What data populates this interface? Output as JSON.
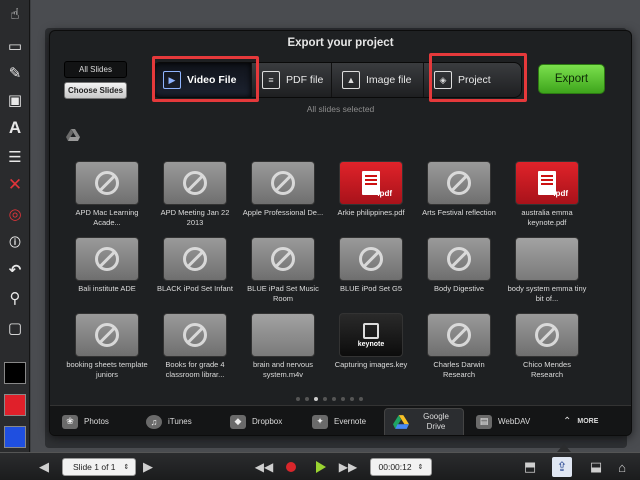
{
  "dialog": {
    "title": "Export your project",
    "scope_all": "All Slides",
    "scope_choose": "Choose Slides",
    "selected_prefix": "All",
    "selected_suffix": "slides selected",
    "export_label": "Export"
  },
  "formats": [
    {
      "label": "Video File",
      "icon": "film-icon"
    },
    {
      "label": "PDF file",
      "icon": "document-icon"
    },
    {
      "label": "Image file",
      "icon": "image-icon"
    },
    {
      "label": "Project",
      "icon": "project-icon"
    }
  ],
  "files": [
    {
      "name": "APD Mac Learning Acade...",
      "type": "blocked"
    },
    {
      "name": "APD Meeting Jan 22 2013",
      "type": "blocked"
    },
    {
      "name": "Apple Professional De...",
      "type": "blocked"
    },
    {
      "name": "Arkie philippines.pdf",
      "type": "pdf"
    },
    {
      "name": "Arts Festival reflection",
      "type": "blocked"
    },
    {
      "name": "australia emma keynote.pdf",
      "type": "pdf"
    },
    {
      "name": "Bali institute ADE",
      "type": "blocked"
    },
    {
      "name": "BLACK iPod Set Infant",
      "type": "blocked"
    },
    {
      "name": "BLUE iPad Set Music Room",
      "type": "blocked"
    },
    {
      "name": "BLUE iPod Set G5",
      "type": "blocked"
    },
    {
      "name": "Body Digestive",
      "type": "blocked"
    },
    {
      "name": "body system emma tiny bit of...",
      "type": "plain"
    },
    {
      "name": "booking sheets template juniors",
      "type": "blocked"
    },
    {
      "name": "Books for grade 4 classroom librar...",
      "type": "blocked"
    },
    {
      "name": "brain and nervous system.m4v",
      "type": "plain"
    },
    {
      "name": "Capturing images.key",
      "type": "keynote"
    },
    {
      "name": "Charles Darwin Research",
      "type": "blocked"
    },
    {
      "name": "Chico Mendes Research",
      "type": "blocked"
    }
  ],
  "pdf_tag": ".pdf",
  "keynote_tag": "keynote",
  "services": [
    {
      "label": "Photos",
      "icon": "photos-icon"
    },
    {
      "label": "iTunes",
      "icon": "itunes-icon"
    },
    {
      "label": "Dropbox",
      "icon": "dropbox-icon"
    },
    {
      "label": "Evernote",
      "icon": "evernote-icon"
    },
    {
      "label": "Google Drive",
      "icon": "google-drive-icon"
    },
    {
      "label": "WebDAV",
      "icon": "webdav-icon"
    },
    {
      "label": "MORE",
      "icon": "more-icon"
    }
  ],
  "bottom": {
    "slide_label": "Slide 1 of 1",
    "time": "00:00:12"
  },
  "colors": {
    "highlight": "#e5393b",
    "export_green": "#5cc436",
    "swatch_black": "#000000",
    "swatch_red": "#e0202a",
    "swatch_blue": "#1f4fe0"
  }
}
